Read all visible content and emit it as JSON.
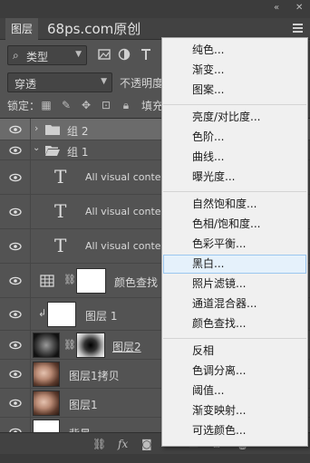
{
  "panel": {
    "tab_label": "图层",
    "watermark": "68ps.com原创",
    "collapse_icon": "double-chevron-icon",
    "close_icon": "close-icon",
    "menu_icon": "panel-menu-icon"
  },
  "filter": {
    "kind_label": "类型",
    "filter_icons": [
      "image-filter-icon",
      "adjustment-filter-icon",
      "type-filter-icon"
    ]
  },
  "blend": {
    "mode": "穿透",
    "opacity_label": "不透明度"
  },
  "lock": {
    "label": "锁定：",
    "fill_label": "填充"
  },
  "layers": [
    {
      "name": "组 2",
      "kind": "group",
      "expanded": false,
      "selected": true
    },
    {
      "name": "组 1",
      "kind": "group",
      "expanded": true,
      "selected": false
    },
    {
      "name": "All visual content",
      "kind": "text"
    },
    {
      "name": "All visual content",
      "kind": "text"
    },
    {
      "name": "All visual content",
      "kind": "text"
    },
    {
      "name": "颜色查找",
      "kind": "adjustment"
    },
    {
      "name": "图层 1",
      "kind": "clipped"
    },
    {
      "name": "图层2",
      "kind": "masked"
    },
    {
      "name": "图层1拷贝",
      "kind": "photo"
    },
    {
      "name": "图层1",
      "kind": "photo"
    },
    {
      "name": "背景",
      "kind": "background"
    }
  ],
  "bottombar": {
    "icons": [
      "link-layers-icon",
      "fx-icon",
      "add-mask-icon",
      "adjustment-layer-icon",
      "new-group-icon",
      "new-layer-icon",
      "delete-icon"
    ],
    "fx_label": "fx"
  },
  "menu": {
    "groups": [
      [
        "纯色...",
        "渐变...",
        "图案..."
      ],
      [
        "亮度/对比度...",
        "色阶...",
        "曲线...",
        "曝光度..."
      ],
      [
        "自然饱和度...",
        "色相/饱和度...",
        "色彩平衡...",
        "黑白...",
        "照片滤镜...",
        "通道混合器...",
        "颜色查找..."
      ],
      [
        "反相",
        "色调分离...",
        "阈值...",
        "渐变映射...",
        "可选颜色..."
      ]
    ],
    "highlighted": "黑白..."
  },
  "colors": {
    "panel_bg": "#535353",
    "selected_row": "#6b6b6b",
    "menu_bg": "#f0f0f0",
    "menu_highlight": "#e5f1fb"
  }
}
